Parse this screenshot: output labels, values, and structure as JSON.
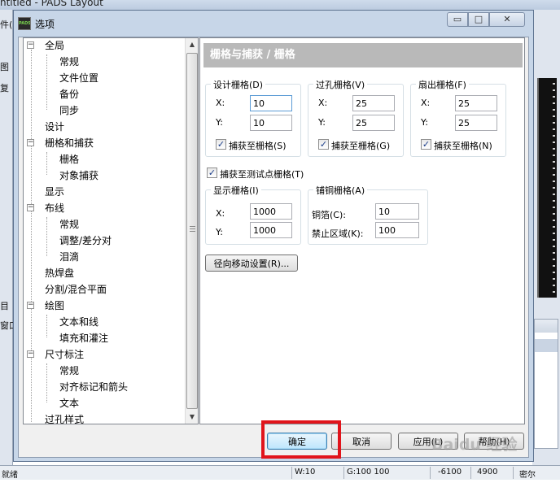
{
  "app": {
    "title": "ntitled - PADS Layout",
    "left_fragments": [
      "件(",
      "图",
      "复",
      "目",
      "窗口"
    ],
    "status": {
      "ready": "就绪",
      "width": "W:10",
      "grid": "G:100 100",
      "x": "-6100",
      "y": "4900",
      "unit": "密尔"
    },
    "watermark": "Baidu 经验"
  },
  "dialog": {
    "icon_text": "PADS",
    "title": "选项",
    "min_glyph": "▭",
    "max_glyph": "□",
    "close_glyph": "✕",
    "tree": [
      {
        "label": "全局",
        "toggle": "−"
      },
      {
        "label": "常规"
      },
      {
        "label": "文件位置"
      },
      {
        "label": "备份"
      },
      {
        "label": "同步"
      },
      {
        "label": "设计"
      },
      {
        "label": "栅格和捕获",
        "toggle": "−"
      },
      {
        "label": "栅格",
        "selected": true
      },
      {
        "label": "对象捕获"
      },
      {
        "label": "显示"
      },
      {
        "label": "布线",
        "toggle": "−"
      },
      {
        "label": "常规"
      },
      {
        "label": "调整/差分对"
      },
      {
        "label": "泪滴"
      },
      {
        "label": "热焊盘"
      },
      {
        "label": "分割/混合平面"
      },
      {
        "label": "绘图",
        "toggle": "−"
      },
      {
        "label": "文本和线"
      },
      {
        "label": "填充和灌注"
      },
      {
        "label": "尺寸标注",
        "toggle": "−"
      },
      {
        "label": "常规"
      },
      {
        "label": "对齐标记和箭头"
      },
      {
        "label": "文本"
      },
      {
        "label": "过孔样式"
      }
    ],
    "page_title": "栅格与捕获 / 栅格",
    "design_grid": {
      "label": "设计栅格(D)",
      "x_label": "X:",
      "x": "10",
      "y_label": "Y:",
      "y": "10",
      "snap_label": "捕获至栅格(S)",
      "snap": true
    },
    "via_grid": {
      "label": "过孔栅格(V)",
      "x_label": "X:",
      "x": "25",
      "y_label": "Y:",
      "y": "25",
      "snap_label": "捕获至栅格(G)",
      "snap": true
    },
    "fanout_grid": {
      "label": "扇出栅格(F)",
      "x_label": "X:",
      "x": "25",
      "y_label": "Y:",
      "y": "25",
      "snap_label": "捕获至栅格(N)",
      "snap": true
    },
    "test_point_snap": {
      "label": "捕获至测试点栅格(T)",
      "checked": true
    },
    "display_grid": {
      "label": "显示栅格(I)",
      "x_label": "X:",
      "x": "1000",
      "y_label": "Y:",
      "y": "1000"
    },
    "copper_grid": {
      "label": "铺铜栅格(A)",
      "hatch_label": "铜箔(C):",
      "hatch": "10",
      "keepout_label": "禁止区域(K):",
      "keepout": "100"
    },
    "radial_button": "径向移动设置(R)...",
    "buttons": {
      "ok": "确定",
      "cancel": "取消",
      "apply": "应用(L)",
      "help": "帮助(H)"
    },
    "check_glyph": "✓",
    "scroll_up": "▲",
    "scroll_down": "▼"
  }
}
